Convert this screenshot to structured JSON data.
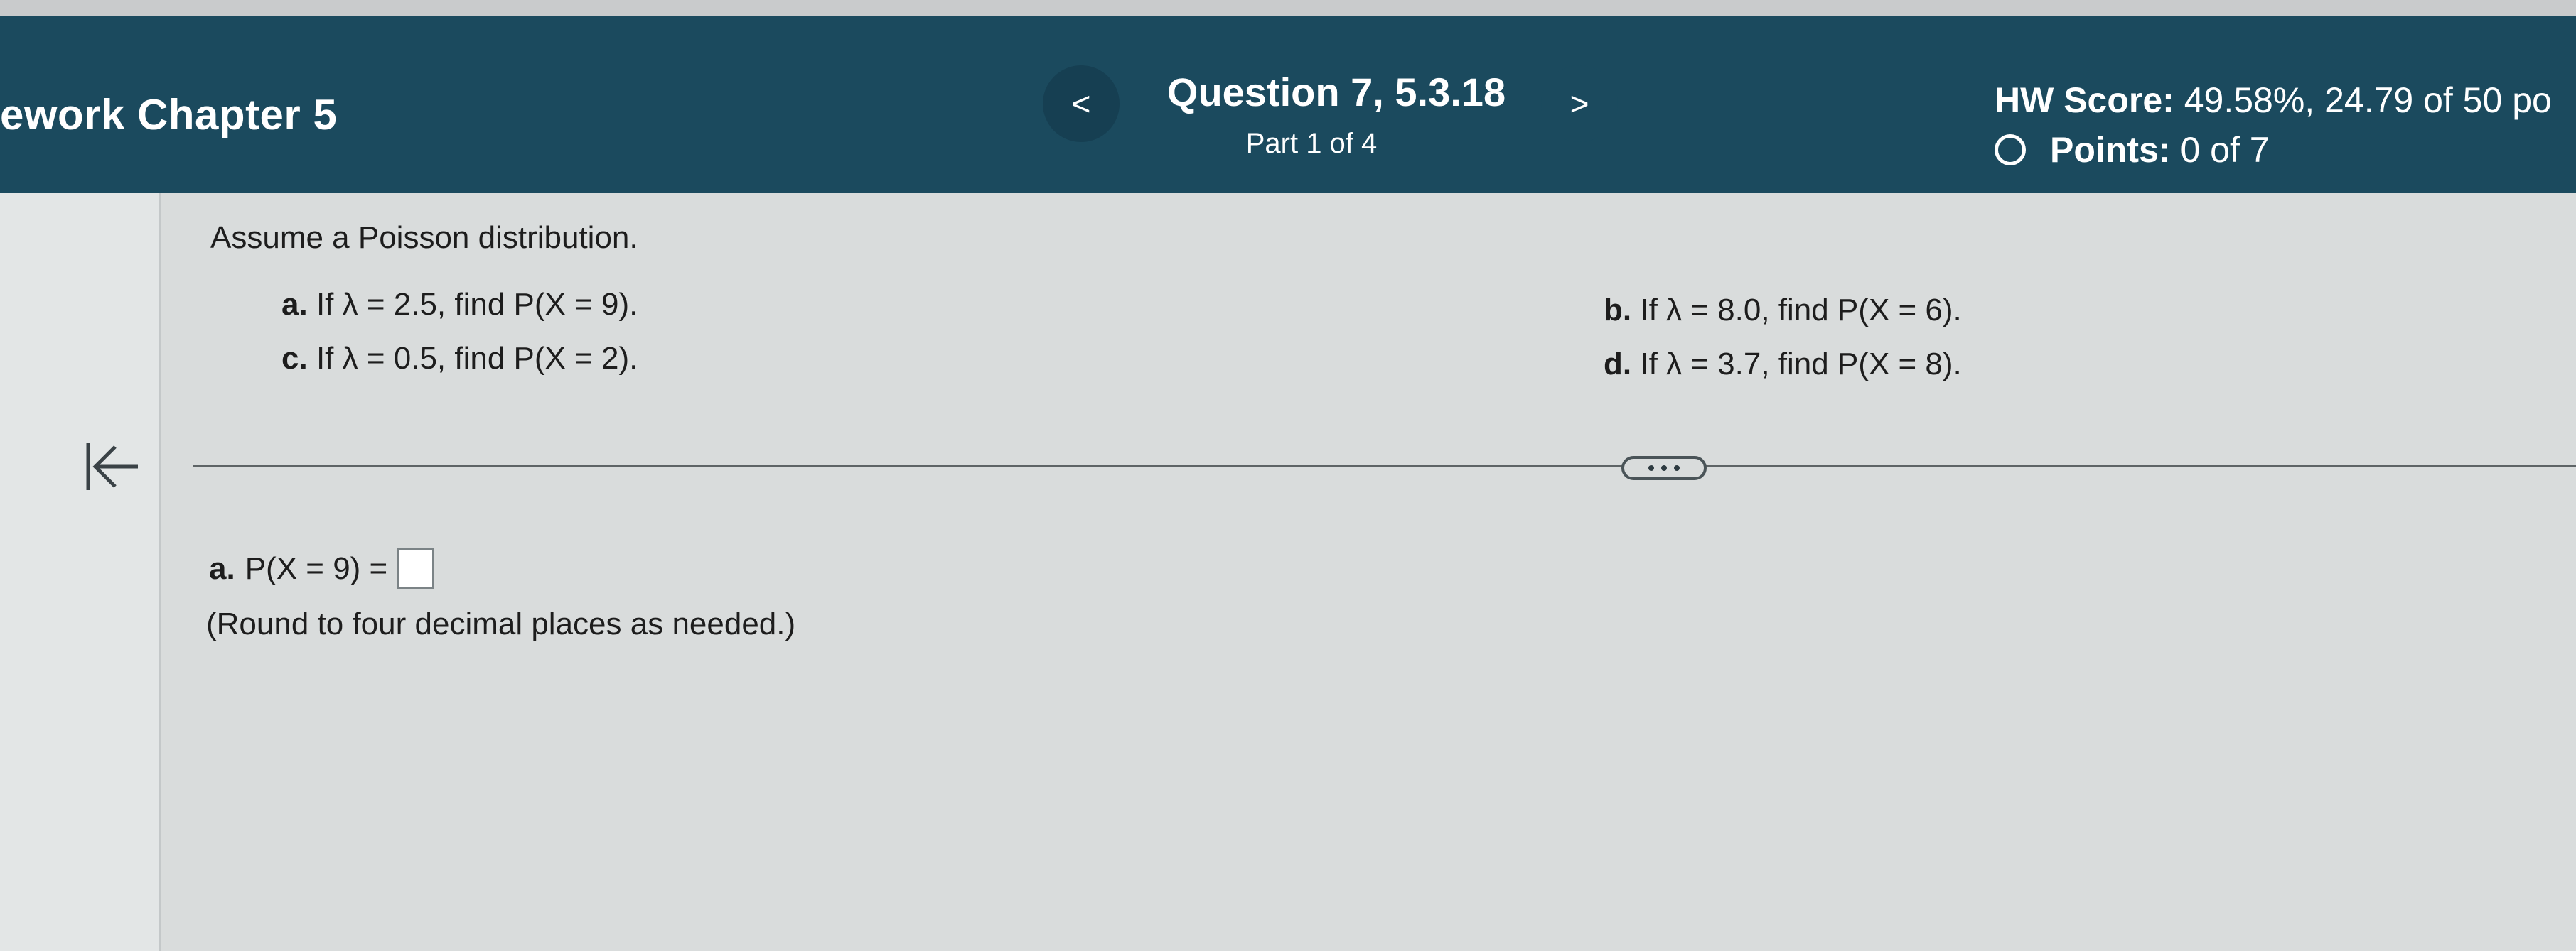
{
  "header": {
    "title": "ework Chapter 5",
    "question_title": "Question 7, 5.3.18",
    "part": "Part 1 of 4",
    "prev_symbol": "<",
    "next_symbol": ">",
    "hw_score_label": "HW Score:",
    "hw_score_value": "49.58%, 24.79 of 50 po",
    "points_label": "Points:",
    "points_value": "0 of 7"
  },
  "question": {
    "prompt": "Assume a Poisson distribution.",
    "parts": [
      {
        "letter": "a.",
        "text": "If λ = 2.5, find P(X = 9)."
      },
      {
        "letter": "b.",
        "text": "If λ = 8.0, find P(X = 6)."
      },
      {
        "letter": "c.",
        "text": "If λ = 0.5, find P(X = 2)."
      },
      {
        "letter": "d.",
        "text": "If λ = 3.7, find P(X = 8)."
      }
    ]
  },
  "answer": {
    "letter": "a.",
    "expression": "P(X = 9) =",
    "value": "",
    "note": "(Round to four decimal places as needed.)"
  },
  "icons": {
    "collapse": "collapse-left-icon",
    "more": "more-dots-icon",
    "points_status": "circle-outline-icon"
  },
  "colors": {
    "header_bg": "#1b4a5e",
    "header_text": "#ffffff",
    "content_bg": "#d9dcdc"
  }
}
